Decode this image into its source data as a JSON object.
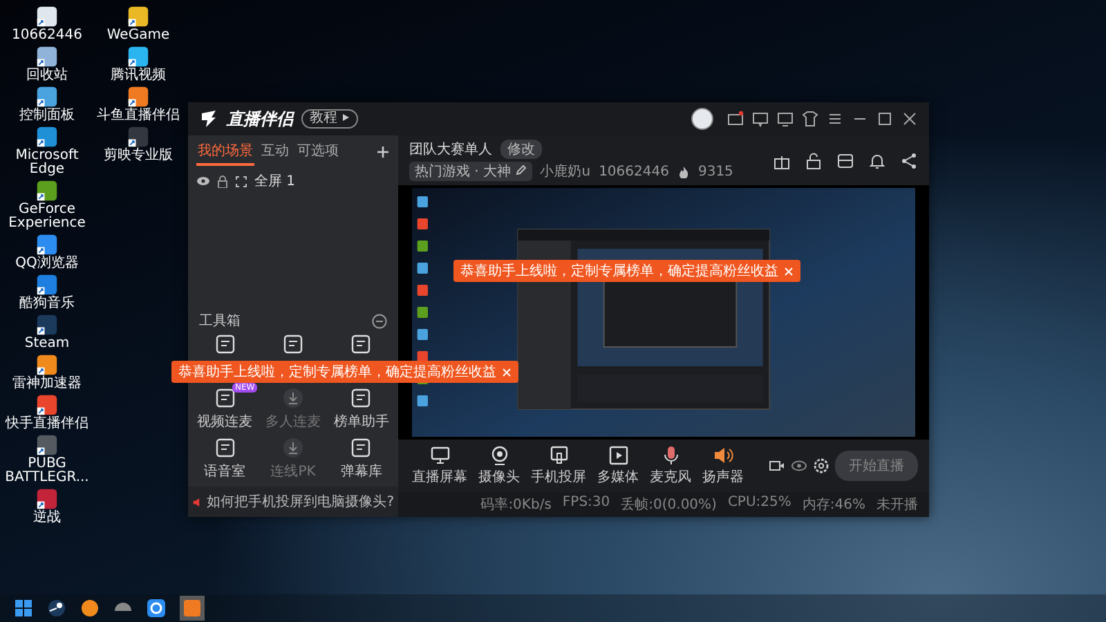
{
  "desktop": {
    "columns": [
      [
        {
          "label": "10662446",
          "color": "#dfe6ee"
        },
        {
          "label": "回收站",
          "color": "#8fb3d9"
        },
        {
          "label": "控制面板",
          "color": "#4aa3df"
        },
        {
          "label": "Microsoft Edge",
          "color": "#1f8fd6"
        },
        {
          "label": "GeForce Experience",
          "color": "#5c9e1e"
        },
        {
          "label": "QQ浏览器",
          "color": "#2d8cf0"
        },
        {
          "label": "酷狗音乐",
          "color": "#1e7fe0"
        },
        {
          "label": "Steam",
          "color": "#1b3a5c"
        },
        {
          "label": "雷神加速器",
          "color": "#f08a1c"
        },
        {
          "label": "快手直播伴侣",
          "color": "#e8452c"
        },
        {
          "label": "PUBG BATTLEGR...",
          "color": "#555a60"
        },
        {
          "label": "逆战",
          "color": "#c4243a"
        }
      ],
      [
        {
          "label": "WeGame",
          "color": "#e9b824"
        },
        {
          "label": "腾讯视频",
          "color": "#2bb5f0"
        },
        {
          "label": "斗鱼直播伴侣",
          "color": "#f07a22"
        },
        {
          "label": "剪映专业版",
          "color": "#333840"
        }
      ]
    ]
  },
  "window": {
    "app_name": "直播伴侣",
    "badge": "教程",
    "left_tabs": [
      {
        "label": "我的场景",
        "selected": true
      },
      {
        "label": "互动",
        "selected": false
      },
      {
        "label": "可选项",
        "selected": false
      }
    ],
    "scene": {
      "label": "全屏 1"
    },
    "toolbox": {
      "title": "工具箱",
      "tools": [
        {
          "disabled": false
        },
        {
          "disabled": false
        },
        {
          "disabled": false
        },
        {
          "label": "视频连麦",
          "disabled": false,
          "badge": "NEW"
        },
        {
          "label": "多人连麦",
          "disabled": true
        },
        {
          "label": "榜单助手",
          "disabled": false
        },
        {
          "label": "语音室",
          "disabled": false
        },
        {
          "label": "连线PK",
          "disabled": true
        },
        {
          "label": "弹幕库",
          "disabled": false
        }
      ],
      "tip": "如何把手机投屏到电脑摄像头?"
    },
    "toast_left": "恭喜助手上线啦，定制专属榜单，确定提高粉丝收益",
    "room": {
      "title": "团队大赛单人",
      "edit_button": "修改",
      "category": "热门游戏 · 大神",
      "nickname": "小鹿奶u",
      "id": "10662446",
      "popularity": "9315"
    },
    "toast_preview": "恭喜助手上线啦，定制专属榜单，确定提高粉丝收益",
    "controls": [
      {
        "label": "直播屏幕",
        "kind": "screen"
      },
      {
        "label": "摄像头",
        "kind": "camera"
      },
      {
        "label": "手机投屏",
        "kind": "phone"
      },
      {
        "label": "多媒体",
        "kind": "media"
      },
      {
        "label": "麦克风",
        "kind": "mic"
      },
      {
        "label": "扬声器",
        "kind": "speaker"
      }
    ],
    "start_button": "开始直播",
    "status": [
      "码率:0Kb/s",
      "FPS:30",
      "丢帧:0(0.00%)",
      "CPU:25%",
      "内存:46%",
      "未开播"
    ]
  }
}
